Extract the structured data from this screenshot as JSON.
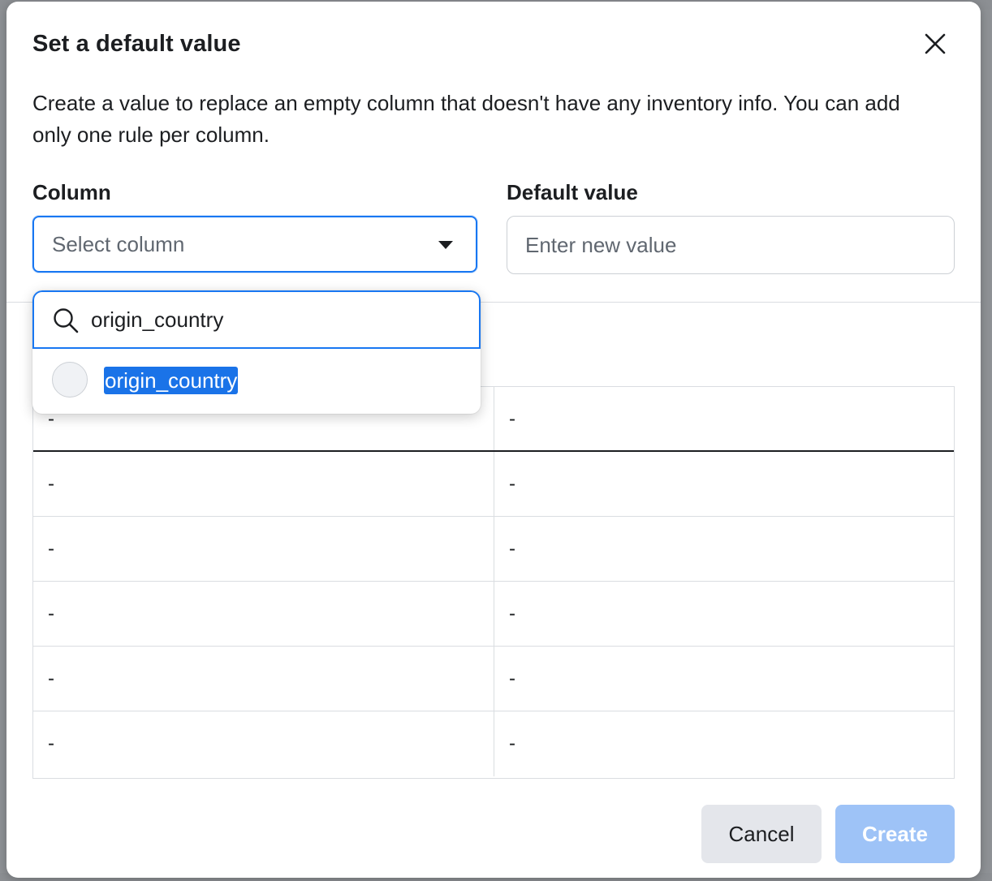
{
  "modal": {
    "title": "Set a default value",
    "description": "Create a value to replace an empty column that doesn't have any inventory info. You can add only one rule per column."
  },
  "fields": {
    "column_label": "Column",
    "column_placeholder": "Select column",
    "default_label": "Default value",
    "default_placeholder": "Enter new value"
  },
  "dropdown": {
    "search_value": "origin_country",
    "options": [
      {
        "label": "origin_country",
        "selected": false,
        "highlighted": true
      }
    ]
  },
  "table": {
    "rows": [
      [
        "-",
        "-"
      ],
      [
        "-",
        "-"
      ],
      [
        "-",
        "-"
      ],
      [
        "-",
        "-"
      ],
      [
        "-",
        "-"
      ],
      [
        "-",
        "-"
      ]
    ]
  },
  "footer": {
    "cancel_label": "Cancel",
    "create_label": "Create"
  },
  "colors": {
    "accent": "#1877f2",
    "create_disabled": "#9ec3f7",
    "selection_highlight": "#1a73e8"
  },
  "icons": {
    "close": "close-icon",
    "caret": "caret-down-icon",
    "search": "search-icon"
  }
}
